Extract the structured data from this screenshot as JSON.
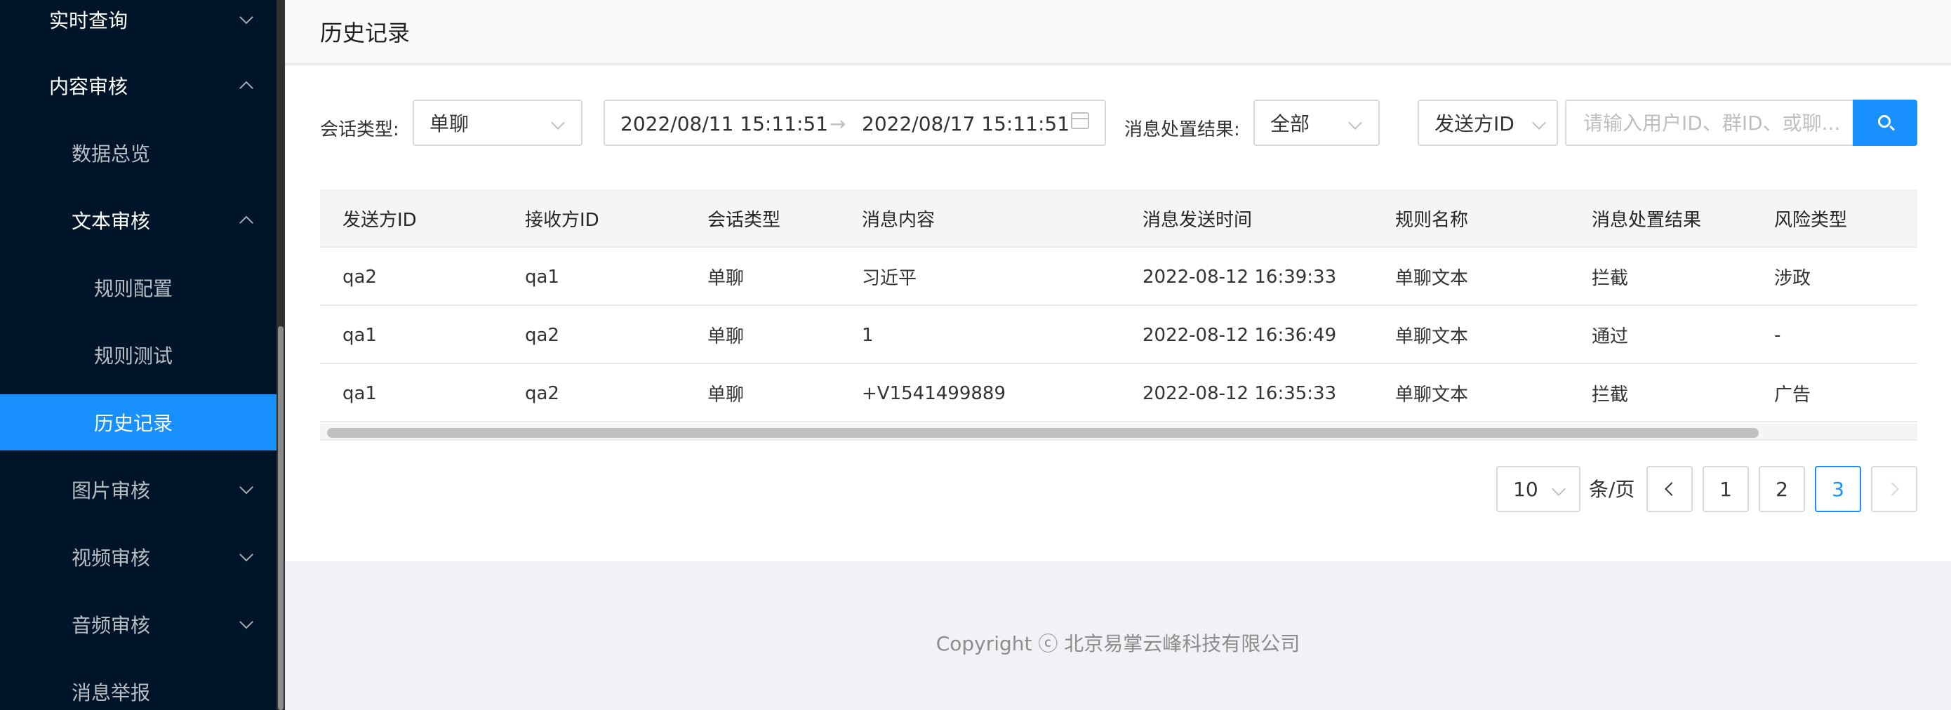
{
  "sidebar": {
    "items": [
      {
        "label": "实时查询",
        "level": 1
      },
      {
        "label": "内容审核",
        "level": 1
      },
      {
        "label": "数据总览",
        "level": 2
      },
      {
        "label": "文本审核",
        "level": 2
      },
      {
        "label": "规则配置",
        "level": 3
      },
      {
        "label": "规则测试",
        "level": 3
      },
      {
        "label": "历史记录",
        "level": 3,
        "active": true
      },
      {
        "label": "图片审核",
        "level": 2
      },
      {
        "label": "视频审核",
        "level": 2
      },
      {
        "label": "音频审核",
        "level": 2
      },
      {
        "label": "消息举报",
        "level": 2
      }
    ]
  },
  "page": {
    "title": "历史记录"
  },
  "filters": {
    "session_type_label": "会话类型:",
    "session_type_value": "单聊",
    "date_start": "2022/08/11 15:11:51",
    "date_arrow": "→",
    "date_end": "2022/08/17 15:11:51",
    "result_label": "消息处置结果:",
    "result_value": "全部",
    "id_type_value": "发送方ID",
    "search_placeholder": "请输入用户ID、群ID、或聊..."
  },
  "table": {
    "columns": [
      "发送方ID",
      "接收方ID",
      "会话类型",
      "消息内容",
      "消息发送时间",
      "规则名称",
      "消息处置结果",
      "风险类型"
    ],
    "rows": [
      [
        "qa2",
        "qa1",
        "单聊",
        "习近平",
        "2022-08-12 16:39:33",
        "单聊文本",
        "拦截",
        "涉政"
      ],
      [
        "qa1",
        "qa2",
        "单聊",
        "1",
        "2022-08-12 16:36:49",
        "单聊文本",
        "通过",
        "-"
      ],
      [
        "qa1",
        "qa2",
        "单聊",
        "+V1541499889",
        "2022-08-12 16:35:33",
        "单聊文本",
        "拦截",
        "广告"
      ]
    ]
  },
  "pagination": {
    "page_size": "10",
    "unit": "条/页",
    "pages": [
      "1",
      "2",
      "3"
    ],
    "current": "3"
  },
  "footer": {
    "copyright": "Copyright ⓒ 北京易掌云峰科技有限公司"
  },
  "colors": {
    "accent": "#1890ff",
    "sidebar_bg": "#001529"
  }
}
